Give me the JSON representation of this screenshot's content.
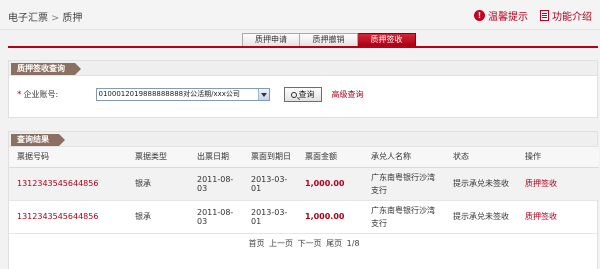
{
  "breadcrumb": {
    "root": "电子汇票",
    "separator": ">",
    "current": "质押"
  },
  "top_actions": {
    "tip_label": "温馨提示",
    "intro_label": "功能介绍"
  },
  "tabs": [
    {
      "label": "质押申请",
      "active": false
    },
    {
      "label": "质押撤销",
      "active": false
    },
    {
      "label": "质押签收",
      "active": true
    }
  ],
  "query_panel": {
    "title": "质押签收查询",
    "account_label": "企业账号:",
    "required_mark": "*",
    "account_value": "0100012019888888888对公活期/xxx公司",
    "query_button": "查询",
    "advanced_link": "高级查询"
  },
  "results_panel": {
    "title": "查询结果",
    "columns": [
      "票据号码",
      "票据类型",
      "出票日期",
      "票面到期日",
      "票面金额",
      "承兑人名称",
      "状态",
      "操作"
    ],
    "rows": [
      {
        "bill_no": "1312343545644856",
        "type": "银承",
        "issue_date": "2011-08-03",
        "due_date": "2013-03-01",
        "amount": "1,000.00",
        "acceptor_line1": "广东南粤银行沙湾",
        "acceptor_line2": "支行",
        "status": "提示承兑未签收",
        "action": "质押签收"
      },
      {
        "bill_no": "1312343545644856",
        "type": "银承",
        "issue_date": "2011-08-03",
        "due_date": "2013-03-01",
        "amount": "1,000.00",
        "acceptor_line1": "广东南粤银行沙湾",
        "acceptor_line2": "支行",
        "status": "提示承兑未签收",
        "action": "质押签收"
      }
    ],
    "pager": {
      "first": "首页",
      "prev": "上一页",
      "next": "下一页",
      "last": "尾页",
      "page_info": "1/8"
    }
  },
  "colors": {
    "accent": "#b3001b",
    "ribbon": "#8b6f61"
  }
}
